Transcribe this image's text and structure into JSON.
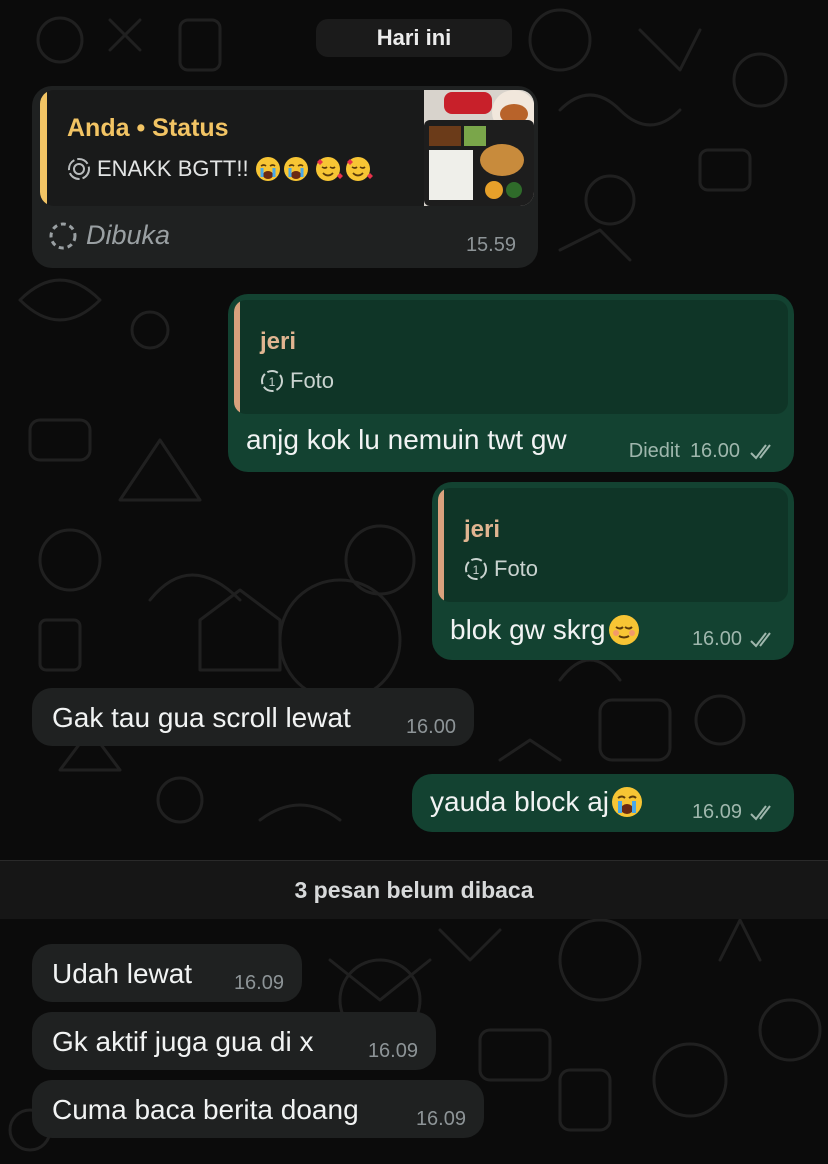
{
  "date_chip": "Hari ini",
  "status_reply": {
    "author": "Anda",
    "separator": "•",
    "kind": "Status",
    "caption": "ENAKK BGTT!!",
    "opened_label": "Dibuka",
    "time": "15.59"
  },
  "messages": [
    {
      "direction": "out",
      "quote_name": "jeri",
      "quote_type": "Foto",
      "text": "anjg kok lu nemuin twt gw",
      "edited_label": "Diedit",
      "time": "16.00"
    },
    {
      "direction": "out",
      "quote_name": "jeri",
      "quote_type": "Foto",
      "text": "blok gw skrg",
      "time": "16.00"
    },
    {
      "direction": "in",
      "text": "Gak tau gua scroll lewat",
      "time": "16.00"
    },
    {
      "direction": "out",
      "text": "yauda block aj",
      "time": "16.09"
    },
    {
      "direction": "in",
      "text": "Udah lewat",
      "time": "16.09"
    },
    {
      "direction": "in",
      "text": "Gk aktif juga gua di x",
      "time": "16.09"
    },
    {
      "direction": "in",
      "text": "Cuma baca berita doang",
      "time": "16.09"
    }
  ],
  "unread_divider": "3 pesan belum dibaca",
  "colors": {
    "incoming_bubble": "#1f2121",
    "outgoing_bubble": "#134231",
    "status_name": "#f2c464",
    "quote_bar_in": "#f2c464",
    "quote_bar_out": "#d9a17d"
  }
}
